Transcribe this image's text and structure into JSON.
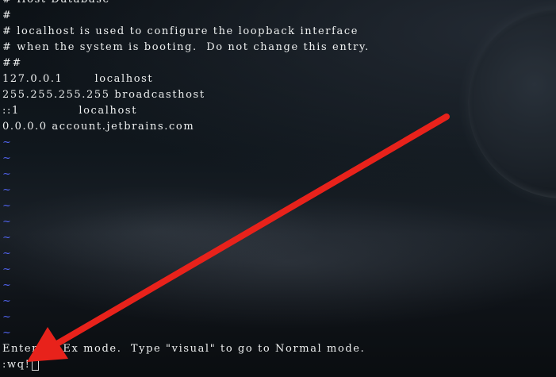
{
  "file_lines": [
    "# Host Database",
    "#",
    "# localhost is used to configure the loopback interface",
    "# when the system is booting.  Do not change this entry.",
    "##",
    "127.0.0.1       localhost",
    "255.255.255.255 broadcasthost",
    "::1             localhost",
    "0.0.0.0 account.jetbrains.com"
  ],
  "empty_line_marker": "~",
  "empty_line_count": 13,
  "status_message": "Entering Ex mode.  Type \"visual\" to go to Normal mode.",
  "command_line": ":wq!",
  "colors": {
    "text": "#eef0f0",
    "tilde": "#4f61e8",
    "annotation_arrow": "#e8221b"
  }
}
